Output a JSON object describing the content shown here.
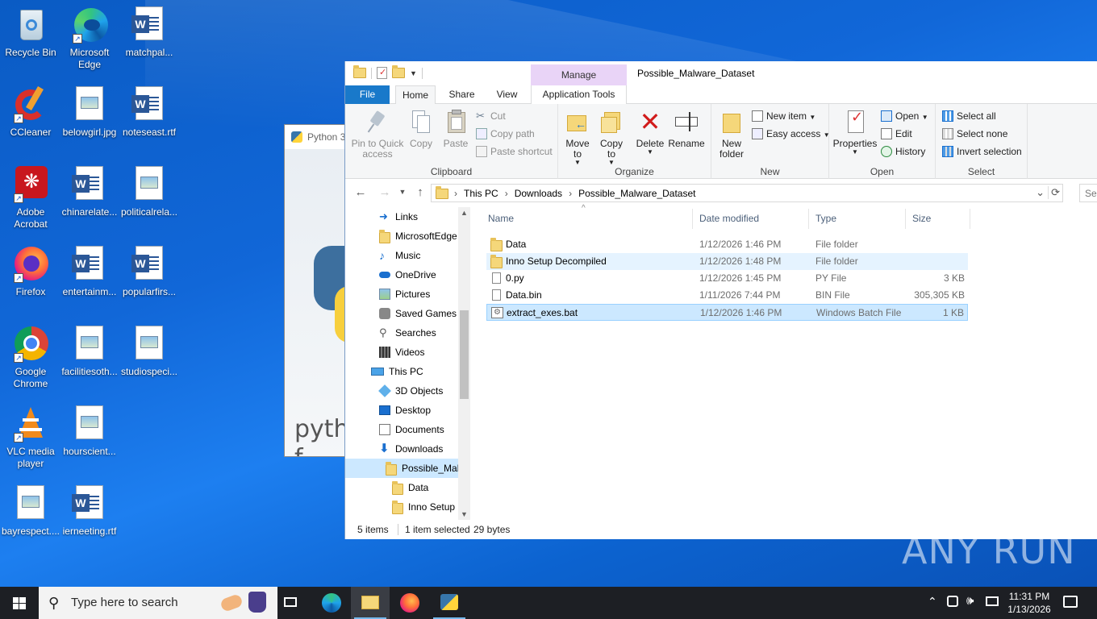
{
  "desktop": {
    "icons": [
      {
        "label": "Recycle Bin"
      },
      {
        "label": "Microsoft Edge"
      },
      {
        "label": "matchpal..."
      },
      {
        "label": "CCleaner"
      },
      {
        "label": "belowgirl.jpg"
      },
      {
        "label": "noteseast.rtf"
      },
      {
        "label": "Adobe Acrobat"
      },
      {
        "label": "chinarelate..."
      },
      {
        "label": "politicalrela..."
      },
      {
        "label": "Firefox"
      },
      {
        "label": "entertainm..."
      },
      {
        "label": "popularfirs..."
      },
      {
        "label": "Google Chrome"
      },
      {
        "label": "facilitiesoth..."
      },
      {
        "label": "studiospeci..."
      },
      {
        "label": "VLC media player"
      },
      {
        "label": "hourscient..."
      },
      {
        "label": "bayrespect...."
      },
      {
        "label": "ierneeting.rtf"
      }
    ]
  },
  "python_window": {
    "title": "Python 3",
    "art_text": "pytho\nf\nwindo"
  },
  "explorer": {
    "window_title": "Possible_Malware_Dataset",
    "context_tab": "Manage",
    "tabs": {
      "file": "File",
      "home": "Home",
      "share": "Share",
      "view": "View",
      "app_tools": "Application Tools"
    },
    "ribbon": {
      "clipboard": {
        "pin": "Pin to Quick access",
        "copy": "Copy",
        "paste": "Paste",
        "cut": "Cut",
        "copy_path": "Copy path",
        "paste_shortcut": "Paste shortcut",
        "label": "Clipboard"
      },
      "organize": {
        "move_to": "Move to",
        "copy_to": "Copy to",
        "delete": "Delete",
        "rename": "Rename",
        "label": "Organize"
      },
      "new": {
        "new_folder": "New folder",
        "new_item": "New item",
        "easy_access": "Easy access",
        "label": "New"
      },
      "open": {
        "properties": "Properties",
        "open": "Open",
        "edit": "Edit",
        "history": "History",
        "label": "Open"
      },
      "select": {
        "select_all": "Select all",
        "select_none": "Select none",
        "invert": "Invert selection",
        "label": "Select"
      }
    },
    "breadcrumb": [
      "This PC",
      "Downloads",
      "Possible_Malware_Dataset"
    ],
    "search_placeholder": "Sea",
    "nav": [
      {
        "label": "Links"
      },
      {
        "label": "MicrosoftEdge"
      },
      {
        "label": "Music"
      },
      {
        "label": "OneDrive"
      },
      {
        "label": "Pictures"
      },
      {
        "label": "Saved Games"
      },
      {
        "label": "Searches"
      },
      {
        "label": "Videos"
      },
      {
        "label": "This PC"
      },
      {
        "label": "3D Objects"
      },
      {
        "label": "Desktop"
      },
      {
        "label": "Documents"
      },
      {
        "label": "Downloads"
      },
      {
        "label": "Possible_Malw"
      },
      {
        "label": "Data"
      },
      {
        "label": "Inno Setup D"
      }
    ],
    "columns": {
      "name": "Name",
      "date": "Date modified",
      "type": "Type",
      "size": "Size"
    },
    "files": [
      {
        "name": "Data",
        "date": "1/12/2026 1:46 PM",
        "type": "File folder",
        "size": ""
      },
      {
        "name": "Inno Setup Decompiled",
        "date": "1/12/2026 1:48 PM",
        "type": "File folder",
        "size": ""
      },
      {
        "name": "0.py",
        "date": "1/12/2026 1:45 PM",
        "type": "PY File",
        "size": "3 KB"
      },
      {
        "name": "Data.bin",
        "date": "1/11/2026 7:44 PM",
        "type": "BIN File",
        "size": "305,305 KB"
      },
      {
        "name": "extract_exes.bat",
        "date": "1/12/2026 1:46 PM",
        "type": "Windows Batch File",
        "size": "1 KB"
      }
    ],
    "status": {
      "items": "5 items",
      "selected": "1 item selected",
      "bytes": "29 bytes"
    }
  },
  "watermark": "ANY RUN",
  "taskbar": {
    "search_placeholder": "Type here to search",
    "time": "11:31 PM",
    "date": "1/13/2026"
  }
}
